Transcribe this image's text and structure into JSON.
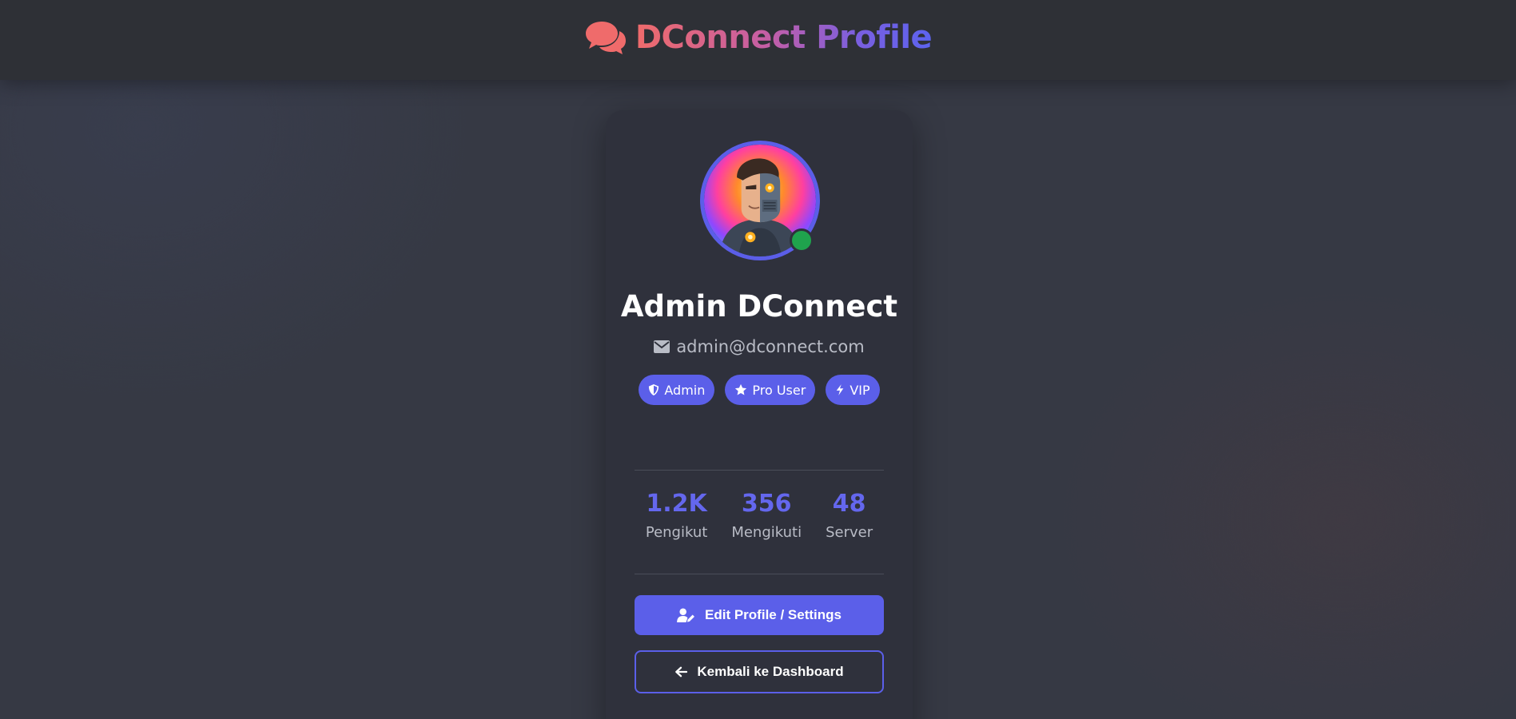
{
  "header": {
    "title": "DConnect Profile",
    "icon": "chat-bubbles-icon",
    "title_gradient": [
      "#ef6b6b",
      "#5c63ee"
    ]
  },
  "profile": {
    "avatar": "robot-half-face-avatar",
    "status": "online",
    "status_color": "#1fa34d",
    "name": "Admin DConnect",
    "email": "admin@dconnect.com",
    "email_icon": "envelope-icon"
  },
  "badges": [
    {
      "label": "Admin",
      "icon": "shield-icon"
    },
    {
      "label": "Pro User",
      "icon": "star-icon"
    },
    {
      "label": "VIP",
      "icon": "bolt-icon"
    }
  ],
  "stats": [
    {
      "value": "1.2K",
      "label": "Pengikut"
    },
    {
      "value": "356",
      "label": "Mengikuti"
    },
    {
      "value": "48",
      "label": "Server"
    }
  ],
  "actions": {
    "edit_label": "Edit Profile / Settings",
    "edit_icon": "user-edit-icon",
    "back_label": "Kembali ke Dashboard",
    "back_icon": "arrow-left-icon"
  },
  "colors": {
    "accent": "#5b5fe9",
    "background": "#363944",
    "card": "#2f313c"
  }
}
